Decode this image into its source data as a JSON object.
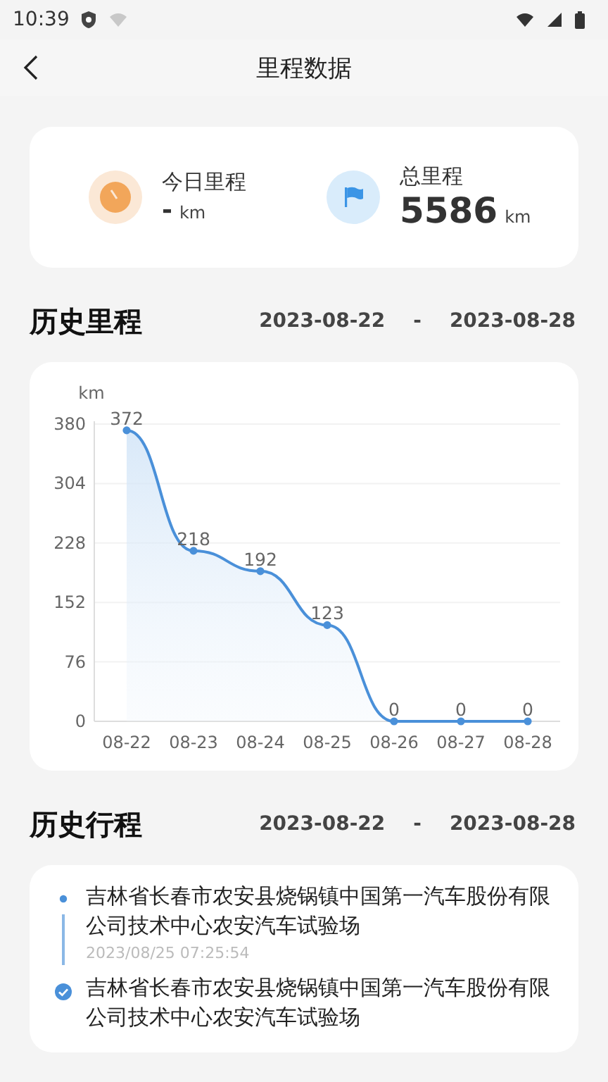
{
  "status_bar": {
    "time": "10:39"
  },
  "header": {
    "title": "里程数据"
  },
  "summary": [
    {
      "kind": "today",
      "label": "今日里程",
      "value": "-",
      "unit": "km"
    },
    {
      "kind": "total",
      "label": "总里程",
      "value": "5586",
      "unit": "km"
    }
  ],
  "history_mileage": {
    "title": "历史里程",
    "date_from": "2023-08-22",
    "separator": "-",
    "date_to": "2023-08-28",
    "chart_data": {
      "type": "area",
      "ylabel": "km",
      "categories": [
        "08-22",
        "08-23",
        "08-24",
        "08-25",
        "08-26",
        "08-27",
        "08-28"
      ],
      "series": [
        {
          "color": "#4a90d9",
          "values": [
            372,
            218,
            192,
            123,
            0,
            0,
            0
          ]
        }
      ],
      "grid": true,
      "ylim": [
        0,
        380
      ],
      "yticks": [
        0,
        76,
        152,
        228,
        304,
        380
      ],
      "data_labels": true
    }
  },
  "history_trips": {
    "title": "历史行程",
    "date_from": "2023-08-22",
    "separator": "-",
    "date_to": "2023-08-28",
    "items": [
      {
        "kind": "dot",
        "address": "吉林省长春市农安县烧锅镇中国第一汽车股份有限公司技术中心农安汽车试验场",
        "time": "2023/08/25 07:25:54"
      },
      {
        "kind": "check",
        "address": "吉林省长春市农安县烧锅镇中国第一汽车股份有限公司技术中心农安汽车试验场"
      }
    ]
  }
}
